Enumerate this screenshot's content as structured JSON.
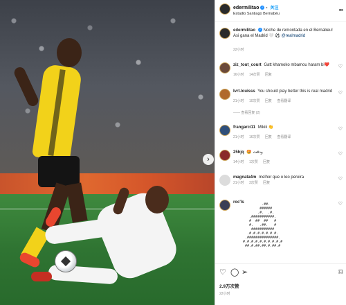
{
  "photo": {
    "next_arrow": "›"
  },
  "post": {
    "header": {
      "username": "edermilitao",
      "follow_label": "关注",
      "location": "Estadio Santiago Bernabéu",
      "more_icon": "more-dots-icon"
    },
    "caption": {
      "username": "edermilitao",
      "text": "Noche de remontada en el Bernabeu! Asi gana el Madrid 🤍 ⚽ ",
      "mention": "@realmadrid",
      "time": "22小时"
    },
    "comments": [
      {
        "username": "ziz_tout_court",
        "text": "Gatt khamoko mbamou haram bi❤️",
        "time": "16小时",
        "likes": "14次赞",
        "reply": "回复"
      },
      {
        "username": "Ivrt.louisss",
        "text": "You should play better this is real madrid",
        "time": "21小时",
        "likes": "10次赞",
        "reply": "回复",
        "translate": "查看翻译",
        "view_replies": "—— 查看回复 (2)"
      },
      {
        "username": "frangarci11",
        "text": "Mikiii 👏",
        "time": "21小时",
        "likes": "16次赞",
        "reply": "回复",
        "translate": "查看翻译"
      },
      {
        "username": "25hjq",
        "text": "🤩 ودقت",
        "time": "14小时",
        "likes": "1次赞",
        "reply": "回复"
      },
      {
        "username": "magnata4m",
        "text": "melhor que o leo pereira",
        "time": "21小时",
        "likes": "3次赞",
        "reply": "回复"
      },
      {
        "username": "roc'ls",
        "text": "",
        "time": "",
        "likes": "",
        "reply": ""
      }
    ],
    "ascii_art": "         .##.\n        ######\n       .#.  .#.\n   .###########.\n   #  ##  ##   #\n   #.   .##.   #\n    ###########\n  .#.#.#.#.#.#.#.\n .###############.\n#.#.#.#.#.#.#.#.#.#\n ##.#.##.##.#.##.#",
    "likes_count": "2.9万次赞",
    "date": "22小时",
    "icons": {
      "like": "heart-icon",
      "comment": "comment-icon",
      "share": "share-icon",
      "save": "bookmark-icon"
    }
  }
}
